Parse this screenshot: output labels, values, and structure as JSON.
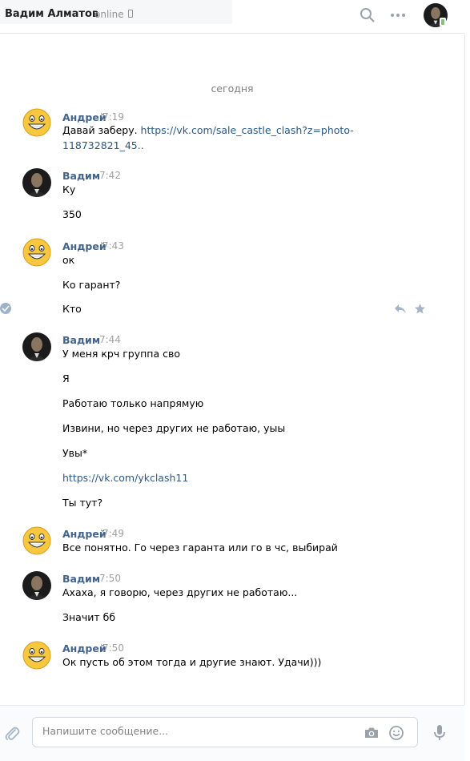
{
  "header": {
    "contact_name": "Вадим Алматов",
    "status": "online",
    "icons": [
      "search-icon",
      "more-icon",
      "phone-icon"
    ]
  },
  "date_divider": "сегодня",
  "messages": [
    {
      "author": "Андрей",
      "time": "7:19",
      "lines": [
        "Давай заберу. ",
        "https://vk.com/sale_castle_clash?z=photo-",
        "118732821_45.."
      ]
    },
    {
      "author": "Вадим",
      "time": "7:42",
      "lines": [
        "Ку",
        "350"
      ]
    },
    {
      "author": "Андрей",
      "time": "7:43",
      "lines": [
        "ок",
        "Ко гарант?",
        "Кто"
      ]
    },
    {
      "author": "Вадим",
      "time": "7:44",
      "lines": [
        "У меня крч группа сво",
        "Я",
        "Работаю только напрямую",
        "Извини, но через других не работаю, уыы",
        "Увы*",
        "https://vk.com/ykclash11",
        "Ты тут?"
      ]
    },
    {
      "author": "Андрей",
      "time": "7:49",
      "lines": [
        "Все понятно. Го через гаранта или го в чс, выбирай"
      ]
    },
    {
      "author": "Вадим",
      "time": "7:50",
      "lines": [
        "Ахаха, я говорю, через других не работаю...",
        "Значит бб"
      ]
    },
    {
      "author": "Андрей",
      "time": "7:50",
      "lines": [
        "Ок пусть об этом тогда и другие знают. Удачи)))"
      ]
    }
  ],
  "composer": {
    "placeholder": "Напишите сообщение..."
  },
  "colors": {
    "author": "#42648b",
    "link": "#2a5885",
    "muted": "#a0a0a0"
  }
}
